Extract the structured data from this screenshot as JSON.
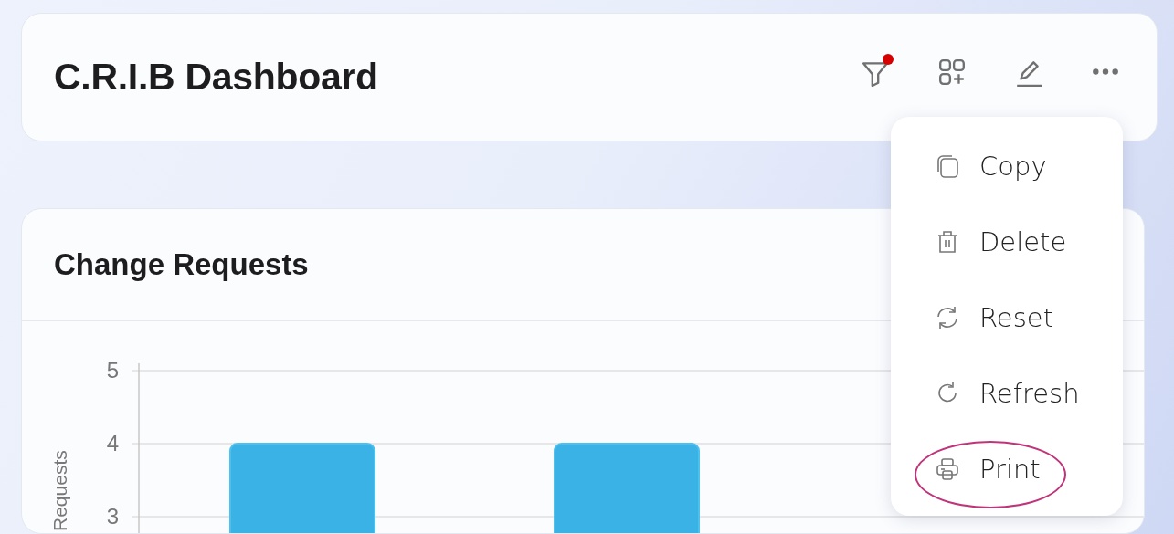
{
  "header": {
    "title": "C.R.I.B Dashboard",
    "actions": [
      {
        "kind": "filter",
        "badge": true
      },
      {
        "kind": "add-widget",
        "badge": false
      },
      {
        "kind": "edit",
        "badge": false
      },
      {
        "kind": "more",
        "badge": false
      }
    ]
  },
  "menu": {
    "items": [
      {
        "kind": "copy",
        "label": "Copy",
        "highlighted": false
      },
      {
        "kind": "delete",
        "label": "Delete",
        "highlighted": false
      },
      {
        "kind": "reset",
        "label": "Reset",
        "highlighted": false
      },
      {
        "kind": "refresh",
        "label": "Refresh",
        "highlighted": false
      },
      {
        "kind": "print",
        "label": "Print",
        "highlighted": true
      }
    ]
  },
  "card": {
    "title": "Change Requests",
    "chart_data": {
      "type": "bar",
      "ylabel": "Requests",
      "ylim": [
        0,
        5
      ],
      "yticks": [
        3,
        4,
        5
      ],
      "series": [
        {
          "color": "#3bb2e6",
          "values": [
            4,
            4
          ]
        }
      ]
    }
  }
}
